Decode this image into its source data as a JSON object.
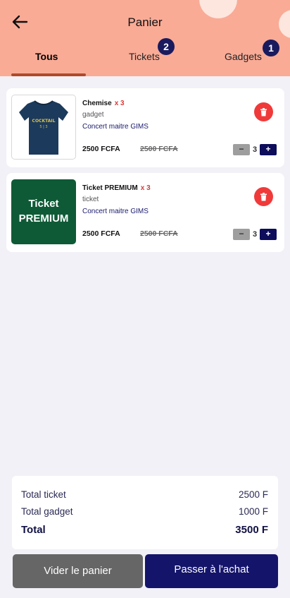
{
  "header": {
    "title": "Panier",
    "tabs": [
      {
        "label": "Tous",
        "active": true
      },
      {
        "label": "Tickets",
        "badge": "2"
      },
      {
        "label": "Gadgets",
        "badge": "1"
      }
    ]
  },
  "colors": {
    "header_bg": "#f9ab96",
    "accent_navy": "#14146b",
    "delete_red": "#f03a3a",
    "ticket_green": "#0f5a36"
  },
  "items": [
    {
      "name": "Chemise",
      "qty_label": "x 3",
      "category": "gadget",
      "event": "Concert maitre GIMS",
      "price": "2500 FCFA",
      "old_price": "2500 FCFA",
      "quantity": "3",
      "image_text": "COCKTAIL 5 | 3",
      "icon": "tshirt-image"
    },
    {
      "name": "Ticket PREMIUM",
      "qty_label": "x 3",
      "category": "ticket",
      "event": "Concert maitre GIMS",
      "price": "2500 FCFA",
      "old_price": "2500 FCFA",
      "quantity": "3",
      "thumb_line1": "Ticket",
      "thumb_line2": "PREMIUM"
    }
  ],
  "stepper": {
    "minus": "−",
    "plus": "+"
  },
  "summary": {
    "ticket_label": "Total ticket",
    "ticket_value": "2500 F",
    "gadget_label": "Total gadget",
    "gadget_value": "1000 F",
    "total_label": "Total",
    "total_value": "3500 F"
  },
  "actions": {
    "empty_label": "Vider le panier",
    "buy_label": "Passer à l'achat"
  }
}
